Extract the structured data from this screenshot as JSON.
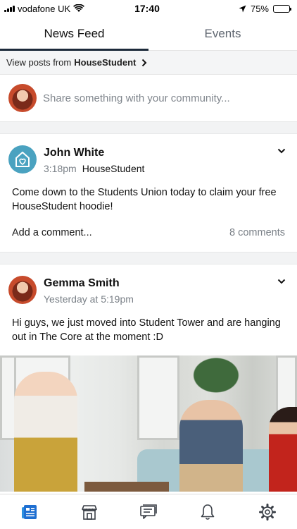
{
  "status_bar": {
    "carrier": "vodafone UK",
    "time": "17:40",
    "battery": "75%",
    "battery_level": 0.75
  },
  "tabs": [
    {
      "label": "News Feed",
      "active": true
    },
    {
      "label": "Events",
      "active": false
    }
  ],
  "filter": {
    "prefix": "View posts from",
    "source": "HouseStudent"
  },
  "composer": {
    "placeholder": "Share something with your community..."
  },
  "posts": [
    {
      "author": "John White",
      "time": "3:18pm",
      "group": "HouseStudent",
      "body": "Come down to the Students Union today to claim your free HouseStudent hoodie!",
      "add_comment": "Add a comment...",
      "comment_count": "8 comments",
      "avatar_icon": "house-heart-icon"
    },
    {
      "author": "Gemma Smith",
      "time": "Yesterday at 5:19pm",
      "body": "Hi guys, we just moved into Student Tower and are hanging out in The Core at the moment :D"
    }
  ],
  "bottom_nav": [
    {
      "icon": "news-feed-icon",
      "active": true
    },
    {
      "icon": "storefront-icon",
      "active": false
    },
    {
      "icon": "messages-icon",
      "active": false
    },
    {
      "icon": "bell-icon",
      "active": false
    },
    {
      "icon": "gear-icon",
      "active": false
    }
  ],
  "colors": {
    "accent": "#1f6fd1",
    "tab_underline": "#1c2a3a",
    "house_avatar": "#4aa2c0"
  }
}
